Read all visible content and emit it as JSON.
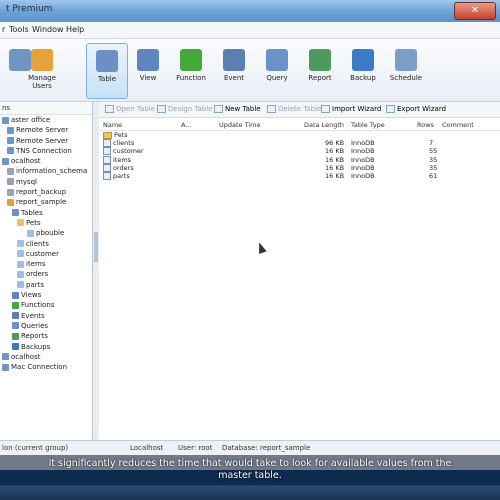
{
  "window": {
    "title": "t Premium",
    "close_symbol": "✕"
  },
  "menu": [
    "r",
    "Tools",
    "Window",
    "Help"
  ],
  "toolbar": [
    {
      "label": "",
      "icon": "connection-icon",
      "color": "#6f95c3"
    },
    {
      "label": "Manage Users",
      "icon": "user-icon",
      "color": "#e8a23b"
    },
    {
      "label": "Table",
      "icon": "table-icon",
      "color": "#6c8fc4",
      "active": true
    },
    {
      "label": "View",
      "icon": "view-icon",
      "color": "#5f86bf"
    },
    {
      "label": "Function",
      "icon": "function-icon",
      "color": "#47a83a"
    },
    {
      "label": "Event",
      "icon": "event-icon",
      "color": "#5c7fb3"
    },
    {
      "label": "Query",
      "icon": "query-icon",
      "color": "#6a92c9"
    },
    {
      "label": "Report",
      "icon": "report-icon",
      "color": "#4d9a5c"
    },
    {
      "label": "Backup",
      "icon": "backup-icon",
      "color": "#3d7cc5"
    },
    {
      "label": "Schedule",
      "icon": "schedule-icon",
      "color": "#7c9dc6"
    }
  ],
  "sidebar": {
    "header": "ns",
    "items": [
      {
        "label": "aster office",
        "indent": 0,
        "color": "#6f95c3"
      },
      {
        "label": "Remote Server",
        "indent": 1,
        "color": "#6f95c3"
      },
      {
        "label": "Remote Server",
        "indent": 1,
        "color": "#6f95c3"
      },
      {
        "label": "TNS Connection",
        "indent": 1,
        "color": "#6f95c3"
      },
      {
        "label": "ocalhost",
        "indent": 0,
        "color": "#6f95c3"
      },
      {
        "label": "information_schema",
        "indent": 1,
        "color": "#9aa3ad"
      },
      {
        "label": "mysql",
        "indent": 1,
        "color": "#9aa3ad"
      },
      {
        "label": "report_backup",
        "indent": 1,
        "color": "#9aa3ad"
      },
      {
        "label": "report_sample",
        "indent": 1,
        "color": "#e0a23a"
      },
      {
        "label": "Tables",
        "indent": 2,
        "color": "#6c8fc4"
      },
      {
        "label": "Pets",
        "indent": 3,
        "color": "#e7c65d"
      },
      {
        "label": "pbouble",
        "indent": 5,
        "color": "#9cc0e7"
      },
      {
        "label": "clients",
        "indent": 3,
        "color": "#9cc0e7"
      },
      {
        "label": "customer",
        "indent": 3,
        "color": "#9cc0e7"
      },
      {
        "label": "items",
        "indent": 3,
        "color": "#9cc0e7"
      },
      {
        "label": "orders",
        "indent": 3,
        "color": "#9cc0e7"
      },
      {
        "label": "parts",
        "indent": 3,
        "color": "#9cc0e7"
      },
      {
        "label": "Views",
        "indent": 2,
        "color": "#5f86bf"
      },
      {
        "label": "Functions",
        "indent": 2,
        "color": "#47a83a"
      },
      {
        "label": "Events",
        "indent": 2,
        "color": "#5c7fb3"
      },
      {
        "label": "Queries",
        "indent": 2,
        "color": "#6a92c9"
      },
      {
        "label": "Reports",
        "indent": 2,
        "color": "#4d9a5c"
      },
      {
        "label": "Backups",
        "indent": 2,
        "color": "#3d7cc5"
      },
      {
        "label": "ocalhost",
        "indent": 0,
        "color": "#6f95c3"
      },
      {
        "label": "Mac Connection",
        "indent": 0,
        "color": "#6f95c3"
      }
    ]
  },
  "object_toolbar": [
    {
      "label": "Open Table",
      "disabled": true
    },
    {
      "label": "Design Table",
      "disabled": true
    },
    {
      "label": "New Table",
      "disabled": false
    },
    {
      "label": "Delete Table",
      "disabled": true
    },
    {
      "label": "Import Wizard",
      "disabled": false
    },
    {
      "label": "Export Wizard",
      "disabled": false
    }
  ],
  "columns": [
    "Name",
    "A...",
    "Update Time",
    "Data Length",
    "Table Type",
    "Rows",
    "Comment"
  ],
  "rows": [
    {
      "name": "Pets",
      "type": "folder",
      "data_length": "",
      "table_type": "",
      "rows": ""
    },
    {
      "name": "clients",
      "type": "table",
      "data_length": "96 KB",
      "table_type": "InnoDB",
      "rows": "7"
    },
    {
      "name": "customer",
      "type": "table",
      "data_length": "16 KB",
      "table_type": "InnoDB",
      "rows": "55"
    },
    {
      "name": "items",
      "type": "table",
      "data_length": "16 KB",
      "table_type": "InnoDB",
      "rows": "35"
    },
    {
      "name": "orders",
      "type": "table",
      "data_length": "16 KB",
      "table_type": "InnoDB",
      "rows": "35"
    },
    {
      "name": "parts",
      "type": "table",
      "data_length": "16 KB",
      "table_type": "InnoDB",
      "rows": "61"
    }
  ],
  "statusbar": {
    "left": "lon (current group)",
    "connection": "Localhost",
    "user": "User: root",
    "database": "Database: report_sample"
  },
  "subtitle": {
    "line1": "It significantly reduces the time that would take to look for available values from the",
    "line2": "master table."
  }
}
